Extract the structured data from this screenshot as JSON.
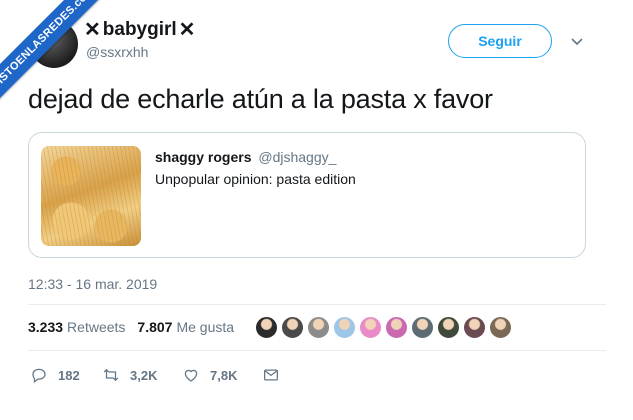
{
  "watermark": {
    "text": "VISTOENLASREDES.com"
  },
  "header": {
    "display_name": "babygirl",
    "name_decorator": "✕",
    "handle": "@ssxrxhh",
    "follow_label": "Seguir"
  },
  "tweet": {
    "text": "dejad de echarle atún a la pasta x favor"
  },
  "quote": {
    "author_name": "shaggy rogers",
    "author_handle": "@djshaggy_",
    "text": "Unpopular opinion: pasta edition"
  },
  "meta": {
    "timestamp": "12:33 - 16 mar. 2019"
  },
  "stats": {
    "retweets_count": "3.233",
    "retweets_label": "Retweets",
    "likes_count": "7.807",
    "likes_label": "Me gusta"
  },
  "likers": [
    {
      "color": "#2b2b2b"
    },
    {
      "color": "#4a4a4a"
    },
    {
      "color": "#8c8c8c"
    },
    {
      "color": "#9ec6e8"
    },
    {
      "color": "#e98bc8"
    },
    {
      "color": "#c96ab0"
    },
    {
      "color": "#5d6b75"
    },
    {
      "color": "#3f4a3b"
    },
    {
      "color": "#6b4b52"
    },
    {
      "color": "#7a6a55"
    }
  ],
  "actions": {
    "replies": "182",
    "retweets": "3,2K",
    "likes": "7,8K"
  },
  "colors": {
    "accent": "#1da1f2",
    "text": "#14171a",
    "muted": "#657786",
    "border": "#e6ecf0"
  }
}
